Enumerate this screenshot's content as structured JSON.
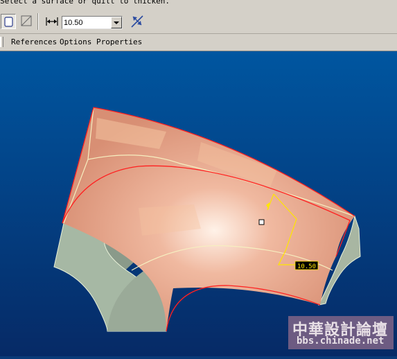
{
  "prompt": {
    "message": "Select a surface or quilt to thicken."
  },
  "toolbar": {
    "solid_icon": "solid-icon",
    "surface_icon": "surface-icon",
    "thickness_dim_icon": "dimension-arrows-icon",
    "thickness_value": "10.50",
    "flip_icon": "flip-direction-icon"
  },
  "tabs": [
    {
      "label": "References"
    },
    {
      "label": "Options"
    },
    {
      "label": "Properties"
    }
  ],
  "viewport": {
    "dimension_label": "10.50",
    "background_top": "#0056a0",
    "background_bottom": "#062a66",
    "surface_color": "#e8a98e",
    "edge_color": "#ff2020",
    "preview_color": "#ffe600"
  },
  "watermark": {
    "title": "中華設計論壇",
    "url": "bbs.chinade.net"
  }
}
